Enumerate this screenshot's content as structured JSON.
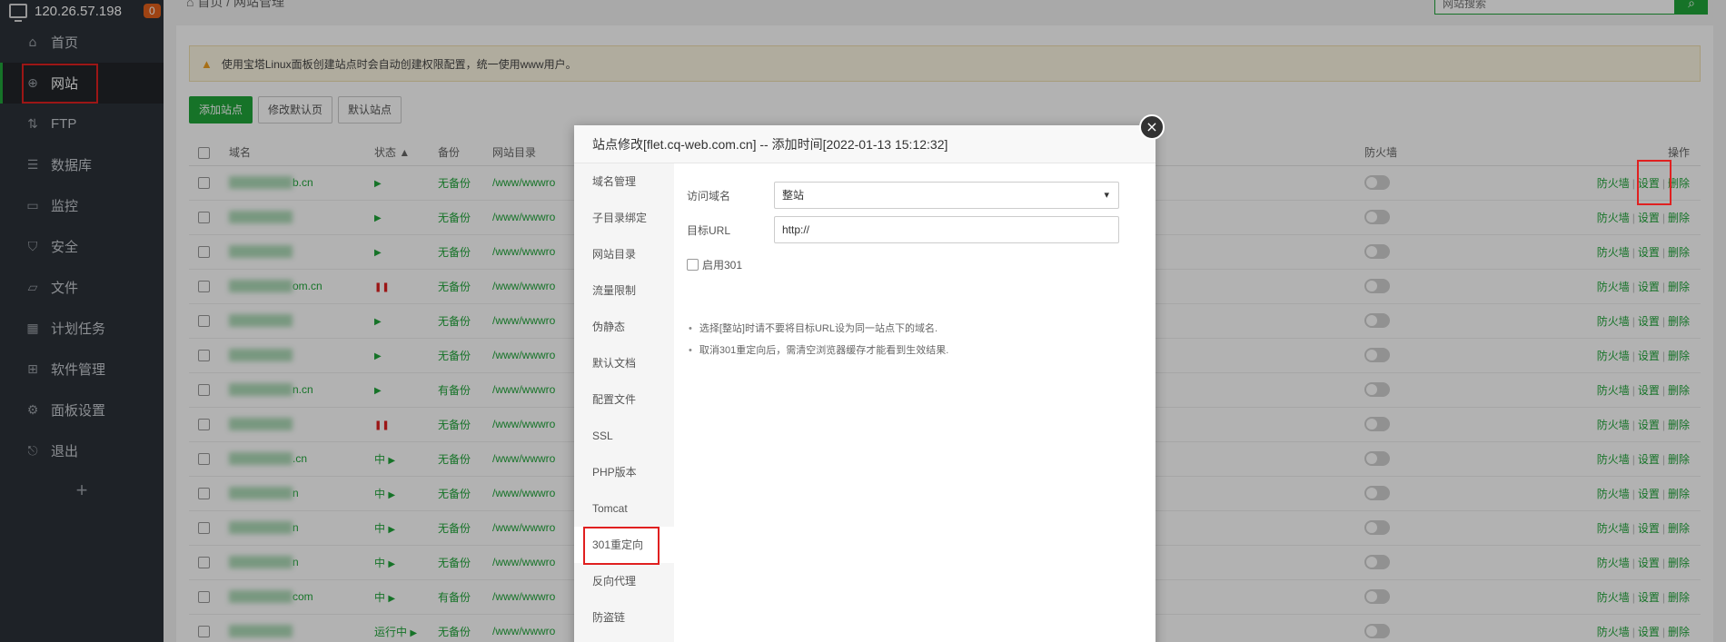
{
  "server": {
    "ip": "120.26.57.198",
    "badge": "0"
  },
  "sidebar": {
    "items": [
      {
        "label": "首页",
        "icon": "home-icon",
        "glyph": "⌂"
      },
      {
        "label": "网站",
        "icon": "globe-icon",
        "glyph": "⊕",
        "active": true
      },
      {
        "label": "FTP",
        "icon": "ftp-icon",
        "glyph": "⇅"
      },
      {
        "label": "数据库",
        "icon": "database-icon",
        "glyph": "☰"
      },
      {
        "label": "监控",
        "icon": "monitor-icon",
        "glyph": "▭"
      },
      {
        "label": "安全",
        "icon": "shield-icon",
        "glyph": "⛉"
      },
      {
        "label": "文件",
        "icon": "folder-icon",
        "glyph": "▱"
      },
      {
        "label": "计划任务",
        "icon": "calendar-icon",
        "glyph": "▦"
      },
      {
        "label": "软件管理",
        "icon": "apps-icon",
        "glyph": "⊞"
      },
      {
        "label": "面板设置",
        "icon": "settings-icon",
        "glyph": "⚙"
      },
      {
        "label": "退出",
        "icon": "logout-icon",
        "glyph": "⎋"
      }
    ],
    "add": "+"
  },
  "breadcrumb": {
    "home": "首页",
    "sep": "/",
    "current": "网站管理"
  },
  "search": {
    "placeholder": "网站搜索",
    "icon": "search-icon"
  },
  "alert": "使用宝塔Linux面板创建站点时会自动创建权限配置，统一使用www用户。",
  "buttons": {
    "add_site": "添加站点",
    "edit_default_page": "修改默认页",
    "default_site": "默认站点"
  },
  "table": {
    "headers": {
      "domain": "域名",
      "status": "状态",
      "backup": "备份",
      "root": "网站目录",
      "firewall": "防火墙",
      "ops": "操作"
    },
    "rows": [
      {
        "domain": "b.cn",
        "status": "run",
        "backup": "无备份",
        "root": "/www/wwwro"
      },
      {
        "domain": "",
        "status": "run",
        "backup": "无备份",
        "root": "/www/wwwro"
      },
      {
        "domain": "",
        "status": "run",
        "backup": "无备份",
        "root": "/www/wwwro"
      },
      {
        "domain": "om.cn",
        "status": "stop",
        "backup": "无备份",
        "root": "/www/wwwro"
      },
      {
        "domain": "",
        "status": "run",
        "backup": "无备份",
        "root": "/www/wwwro"
      },
      {
        "domain": "",
        "status": "run",
        "backup": "无备份",
        "root": "/www/wwwro"
      },
      {
        "domain": "n.cn",
        "status": "run",
        "backup": "有备份",
        "root": "/www/wwwro"
      },
      {
        "domain": "",
        "status": "stop",
        "backup": "无备份",
        "root": "/www/wwwro"
      },
      {
        "domain": ".cn",
        "status": "中",
        "backup": "无备份",
        "root": "/www/wwwro"
      },
      {
        "domain": "n",
        "status": "中",
        "backup": "无备份",
        "root": "/www/wwwro"
      },
      {
        "domain": "n",
        "status": "中",
        "backup": "无备份",
        "root": "/www/wwwro"
      },
      {
        "domain": "n",
        "status": "中",
        "backup": "无备份",
        "root": "/www/wwwro"
      },
      {
        "domain": "com",
        "status": "中",
        "backup": "有备份",
        "root": "/www/wwwro"
      },
      {
        "domain": "",
        "status": "运行中",
        "backup": "无备份",
        "root": "/www/wwwro"
      }
    ],
    "op_labels": {
      "firewall": "防火墙",
      "settings": "设置",
      "delete": "删除",
      "sep": "|"
    }
  },
  "modal": {
    "title": "站点修改[flet.cq-web.com.cn] -- 添加时间[2022-01-13 15:12:32]",
    "close": "×",
    "nav": [
      "域名管理",
      "子目录绑定",
      "网站目录",
      "流量限制",
      "伪静态",
      "默认文档",
      "配置文件",
      "SSL",
      "PHP版本",
      "Tomcat",
      "301重定向",
      "反向代理",
      "防盗链"
    ],
    "active_nav": "301重定向",
    "form": {
      "domain_label": "访问域名",
      "domain_value": "整站",
      "url_label": "目标URL",
      "url_value": "http://",
      "enable_label": "启用301"
    },
    "notes": [
      "选择[整站]时请不要将目标URL设为同一站点下的域名.",
      "取消301重定向后，需清空浏览器缓存才能看到生效结果."
    ]
  },
  "colors": {
    "accent": "#20a53a",
    "sidebar_bg": "#2c3138",
    "highlight": "#e02020",
    "badge": "#e2601c"
  }
}
